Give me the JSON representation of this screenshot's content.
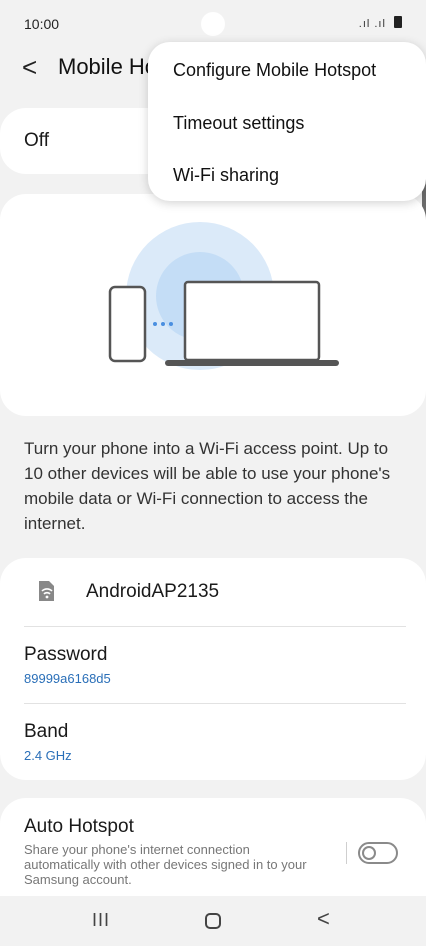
{
  "status_bar": {
    "time": "10:00",
    "signal_icons": ".ıl .ıl"
  },
  "header": {
    "back_icon": "<",
    "title": "Mobile Hotspot"
  },
  "hotspot_toggle": {
    "state_label": "Off"
  },
  "description": "Turn your phone into a Wi-Fi access point. Up to 10 other devices will be able to use your phone's mobile data or Wi-Fi connection to access the internet.",
  "network": {
    "name": "AndroidAP2135",
    "password_label": "Password",
    "password_value": "89999a6168d5",
    "band_label": "Band",
    "band_value": "2.4 GHz"
  },
  "auto_hotspot": {
    "title": "Auto Hotspot",
    "description": "Share your phone's internet connection automatically with other devices signed in to your Samsung account.",
    "enabled": false
  },
  "popup_menu": {
    "items": [
      "Configure Mobile Hotspot",
      "Timeout settings",
      "Wi-Fi sharing"
    ]
  },
  "nav_bar": {
    "recents": "III",
    "back": "<"
  },
  "colors": {
    "accent_link": "#2a6fb8",
    "illustration_circle": "#dbeaf9",
    "illustration_inner": "#c4ddf6"
  },
  "icons": [
    "back-icon",
    "hotspot-network-icon",
    "battery-icon",
    "recents-icon",
    "home-icon",
    "nav-back-icon"
  ]
}
